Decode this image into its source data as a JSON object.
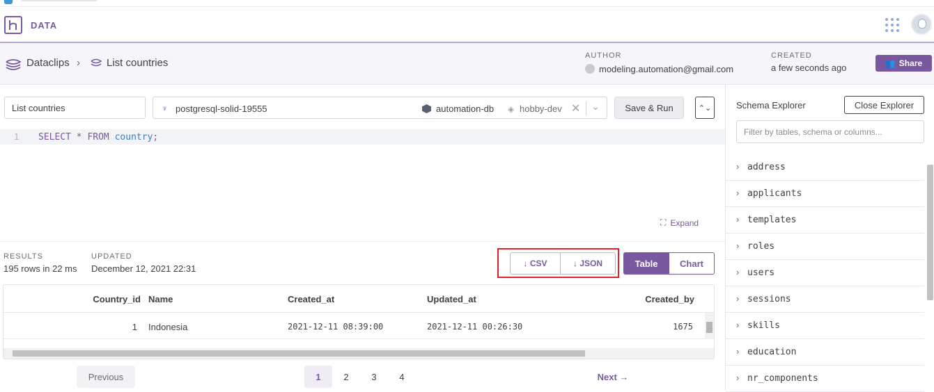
{
  "header": {
    "app_title": "DATA"
  },
  "breadcrumb": {
    "root": "Dataclips",
    "current": "List countries"
  },
  "meta": {
    "author_label": "AUTHOR",
    "author": "modeling.automation@gmail.com",
    "created_label": "CREATED",
    "created": "a few seconds ago"
  },
  "share_label": "Share",
  "query": {
    "name": "List countries",
    "database": "postgresql-solid-19555",
    "app": "automation-db",
    "plan": "hobby-dev",
    "save_run_label": "Save & Run",
    "line_number": "1",
    "sql": {
      "kw1": "SELECT",
      "rest1": " * ",
      "kw2": "FROM",
      "table": " country",
      "end": ";"
    }
  },
  "expand_label": "Expand",
  "results": {
    "results_label": "RESULTS",
    "results_value": "195 rows in 22 ms",
    "updated_label": "UPDATED",
    "updated_value": "December 12, 2021 22:31",
    "csv_label": "↓ CSV",
    "json_label": "↓ JSON",
    "table_tab": "Table",
    "chart_tab": "Chart"
  },
  "table": {
    "columns": [
      "Country_id",
      "Name",
      "Created_at",
      "Updated_at",
      "Created_by"
    ],
    "rows": [
      [
        "1",
        "Indonesia",
        "2021-12-11 08:39:00",
        "2021-12-11 00:26:30",
        "1675"
      ]
    ]
  },
  "pager": {
    "previous": "Previous",
    "pages": [
      "1",
      "2",
      "3",
      "4"
    ],
    "active": "1",
    "next": "Next →"
  },
  "schema_explorer": {
    "title": "Schema Explorer",
    "close_label": "Close Explorer",
    "filter_placeholder": "Filter by tables, schema or columns...",
    "tables": [
      "address",
      "applicants",
      "templates",
      "roles",
      "users",
      "sessions",
      "skills",
      "education",
      "nr_components"
    ]
  },
  "colors": {
    "accent": "#79589f",
    "highlight": "#e0202a"
  }
}
